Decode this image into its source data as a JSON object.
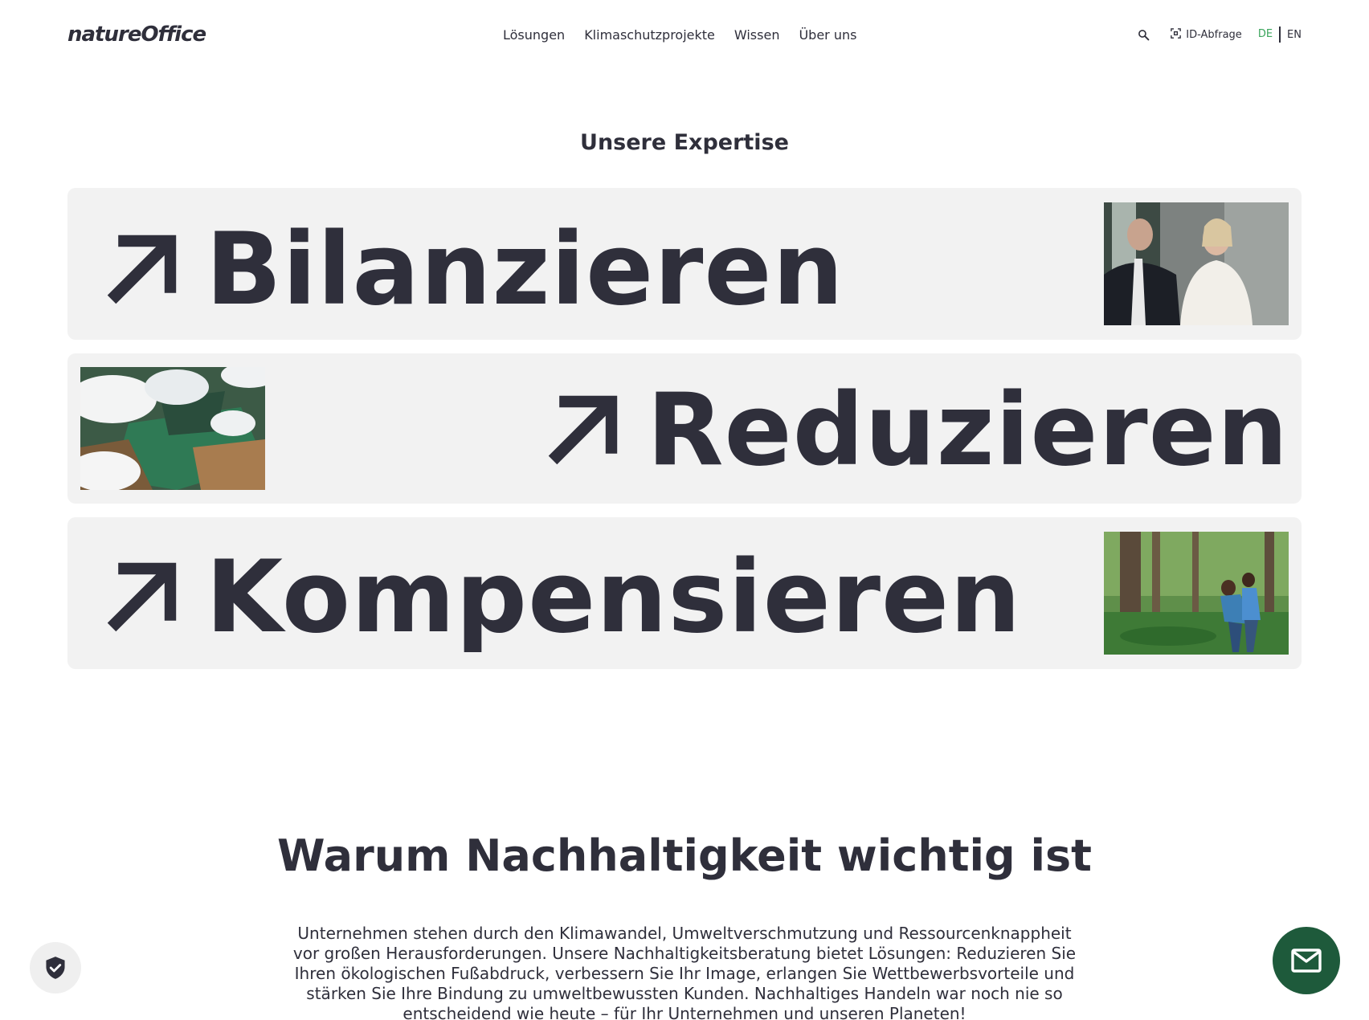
{
  "header": {
    "logo": "natureOffice",
    "nav": [
      {
        "label": "Lösungen"
      },
      {
        "label": "Klimaschutzprojekte"
      },
      {
        "label": "Wissen"
      },
      {
        "label": "Über uns"
      }
    ],
    "search_icon": "search-icon",
    "id_query_label": "ID-Abfrage",
    "id_query_icon": "scan-icon",
    "languages": {
      "active": "DE",
      "other": "EN"
    },
    "accent_color": "#3ba55c"
  },
  "expertise": {
    "title": "Unsere Expertise",
    "cards": [
      {
        "title": "Bilanzieren",
        "icon": "arrow-up-right-icon",
        "image": "business-meeting-photo"
      },
      {
        "title": "Reduzieren",
        "icon": "arrow-up-right-icon",
        "image": "aerial-clouds-photo"
      },
      {
        "title": "Kompensieren",
        "icon": "arrow-up-right-icon",
        "image": "forest-planting-photo"
      }
    ]
  },
  "why": {
    "heading": "Warum Nachhaltigkeit wichtig ist",
    "text": "Unternehmen stehen durch den Klimawandel, Umweltverschmutzung und Ressourcenknappheit vor großen Herausforderungen. Unsere Nachhaltigkeitsberatung bietet Lösungen: Reduzieren Sie Ihren ökologischen Fußabdruck, verbessern Sie Ihr Image, erlangen Sie Wettbewerbsvorteile und stärken Sie Ihre Bindung zu umweltbewussten Kunden. Nachhaltiges Handeln war noch nie so entscheidend wie heute – für Ihr Unternehmen und unseren Planeten!"
  },
  "floating": {
    "privacy_icon": "shield-check-icon",
    "contact_icon": "mail-icon",
    "contact_color": "#1e5a3b"
  }
}
